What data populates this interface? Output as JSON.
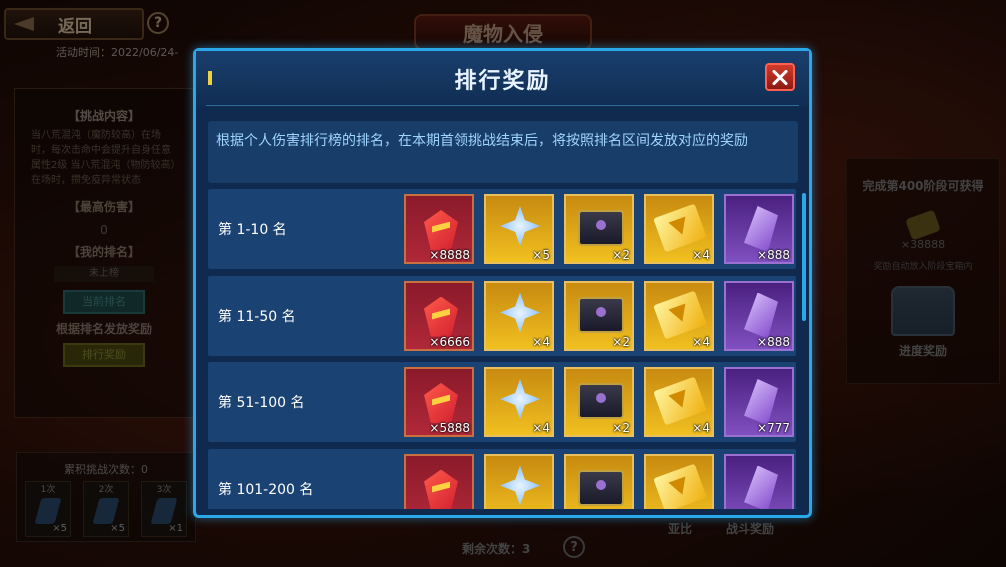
{
  "header": {
    "back_label": "返回",
    "help_glyph": "?",
    "title": "魔物入侵",
    "activity_time": "活动时间：2022/06/24-"
  },
  "left_panel": {
    "challenge_title": "【挑战内容】",
    "challenge_desc": "当八荒混沌（魔防较高）在场时，每次击命中会提升自身任意属性2级 当八荒混沌（物防较高）在场时，攒免疫异常状态",
    "max_damage_title": "【最高伤害】",
    "max_damage_value": "0",
    "my_rank_title": "【我的排名】",
    "my_rank_value": "未上榜",
    "current_rank_button": "当前排名",
    "rank_note": "根据排名发放奖励",
    "rank_reward_button": "排行奖励"
  },
  "cumulative": {
    "title": "累积挑战次数：0",
    "items": [
      {
        "label": "1次",
        "qty": "×5"
      },
      {
        "label": "2次",
        "qty": "×5"
      },
      {
        "label": "3次",
        "qty": "×1"
      }
    ]
  },
  "right_panel": {
    "title": "完成第400阶段可获得",
    "coin_qty": "×38888",
    "sub_note": "奖励自动放入阶段宝箱内",
    "progress_label": "进度奖励"
  },
  "bottom": {
    "remaining": "剩余次数：3",
    "help_glyph": "?",
    "label_a": "亚比",
    "label_b": "战斗奖励"
  },
  "modal": {
    "title": "排行奖励",
    "description": "根据个人伤害排行榜的排名，在本期首领挑战结束后，将按照排名区间发放对应的奖励",
    "rows": [
      {
        "rank": "第 1-10 名",
        "items": [
          {
            "icon": "red-gem-icon",
            "qty": "×8888"
          },
          {
            "icon": "blue-crystal-icon",
            "qty": "×5"
          },
          {
            "icon": "treasure-chest-icon",
            "qty": "×2"
          },
          {
            "icon": "gold-ticket-icon",
            "qty": "×4"
          },
          {
            "icon": "purple-crystal-icon",
            "qty": "×888"
          }
        ]
      },
      {
        "rank": "第 11-50 名",
        "items": [
          {
            "icon": "red-gem-icon",
            "qty": "×6666"
          },
          {
            "icon": "blue-crystal-icon",
            "qty": "×4"
          },
          {
            "icon": "treasure-chest-icon",
            "qty": "×2"
          },
          {
            "icon": "gold-ticket-icon",
            "qty": "×4"
          },
          {
            "icon": "purple-crystal-icon",
            "qty": "×888"
          }
        ]
      },
      {
        "rank": "第 51-100 名",
        "items": [
          {
            "icon": "red-gem-icon",
            "qty": "×5888"
          },
          {
            "icon": "blue-crystal-icon",
            "qty": "×4"
          },
          {
            "icon": "treasure-chest-icon",
            "qty": "×2"
          },
          {
            "icon": "gold-ticket-icon",
            "qty": "×4"
          },
          {
            "icon": "purple-crystal-icon",
            "qty": "×777"
          }
        ]
      },
      {
        "rank": "第 101-200 名",
        "items": [
          {
            "icon": "red-gem-icon",
            "qty": ""
          },
          {
            "icon": "blue-crystal-icon",
            "qty": ""
          },
          {
            "icon": "treasure-chest-icon",
            "qty": ""
          },
          {
            "icon": "gold-ticket-icon",
            "qty": ""
          },
          {
            "icon": "purple-crystal-icon",
            "qty": ""
          }
        ]
      }
    ]
  },
  "colors": {
    "modal_border": "#2aa8e8",
    "modal_bg": "#0f2a4e",
    "desc_text": "#9fd4ff",
    "close_red": "#d23a2a"
  }
}
